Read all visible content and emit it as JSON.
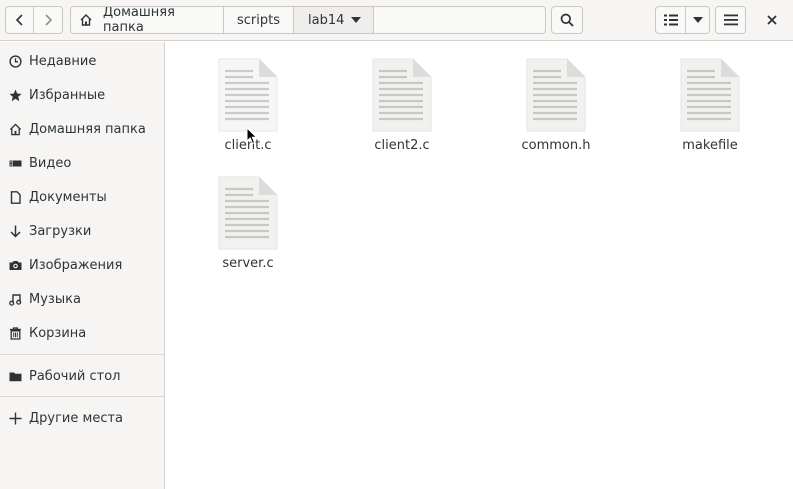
{
  "header": {
    "path": [
      {
        "label": "Домашняя папка",
        "icon": "home-icon"
      },
      {
        "label": "scripts"
      },
      {
        "label": "lab14",
        "has_dropdown": true
      }
    ],
    "path_entry_value": ""
  },
  "sidebar": {
    "items": [
      {
        "label": "Недавние",
        "icon": "clock-icon"
      },
      {
        "label": "Избранные",
        "icon": "star-icon"
      },
      {
        "label": "Домашняя папка",
        "icon": "home-icon"
      },
      {
        "label": "Видео",
        "icon": "video-icon"
      },
      {
        "label": "Документы",
        "icon": "document-icon"
      },
      {
        "label": "Загрузки",
        "icon": "download-icon"
      },
      {
        "label": "Изображения",
        "icon": "camera-icon"
      },
      {
        "label": "Музыка",
        "icon": "music-icon"
      },
      {
        "label": "Корзина",
        "icon": "trash-icon"
      },
      {
        "label": "Рабочий стол",
        "icon": "folder-icon"
      },
      {
        "label": "Другие места",
        "icon": "plus-icon"
      }
    ]
  },
  "files": [
    {
      "name": "client.c"
    },
    {
      "name": "client2.c"
    },
    {
      "name": "common.h"
    },
    {
      "name": "makefile"
    },
    {
      "name": "server.c"
    }
  ],
  "colors": {
    "header_bg": "#f6f5f4",
    "sidebar_bg": "#f6f5f4",
    "border": "#cdc7c2",
    "text": "#2e3436",
    "doc_page": "#f3f3f2",
    "doc_lines": "#c9c9c7"
  }
}
